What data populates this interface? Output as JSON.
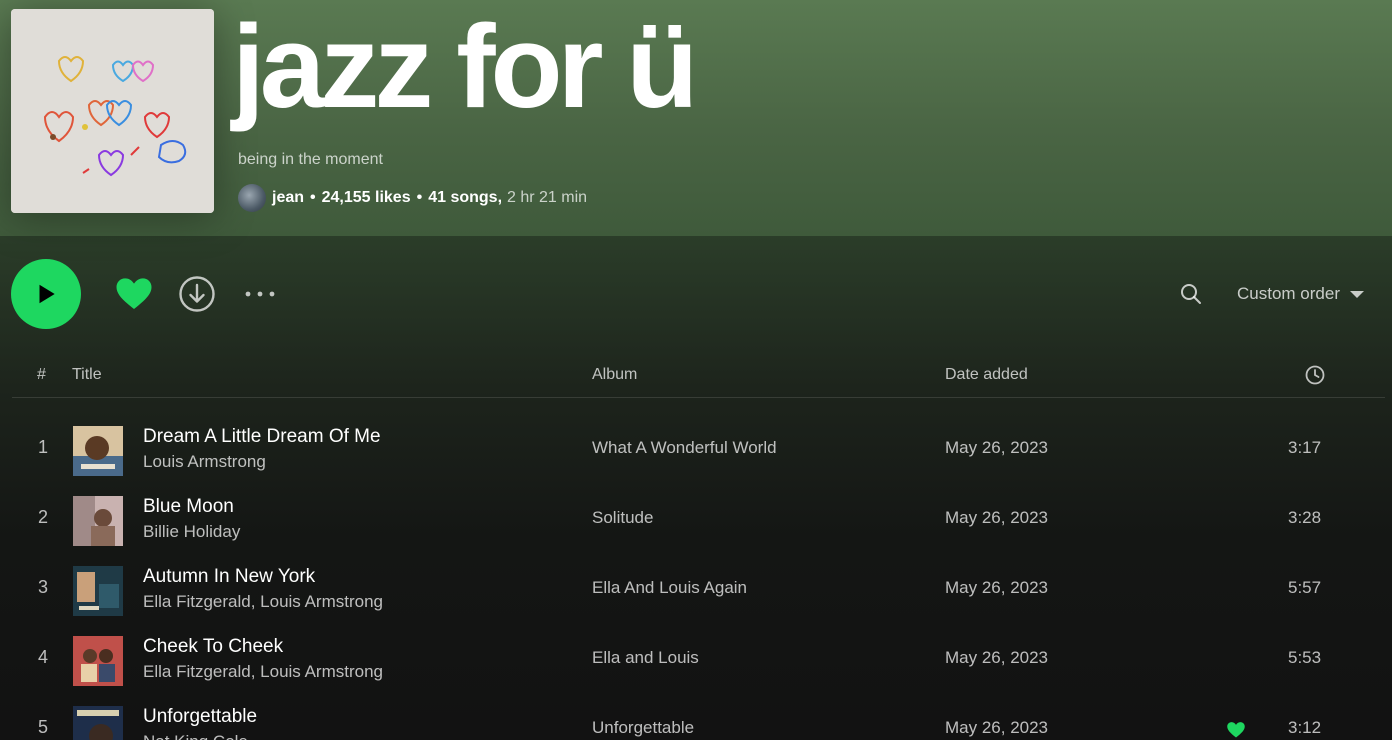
{
  "playlist": {
    "title": "jazz for ü",
    "description": "being in the moment",
    "owner": "jean",
    "likes": "24,155 likes",
    "songs": "41 songs,",
    "duration": "2 hr 21 min",
    "separator": "•"
  },
  "actions": {
    "play_icon": "play-icon",
    "heart_icon": "heart-filled-icon",
    "download_icon": "download-icon",
    "more_icon": "more-options-icon",
    "search_icon": "search-icon",
    "sort_label": "Custom order"
  },
  "columns": {
    "num": "#",
    "title": "Title",
    "album": "Album",
    "date": "Date added",
    "duration_icon": "clock-icon"
  },
  "colors": {
    "accent": "#1ed760",
    "header_bg": "#537149",
    "body_bg": "#121212"
  },
  "tracks": [
    {
      "num": "1",
      "name": "Dream A Little Dream Of Me",
      "artist": "Louis Armstrong",
      "album": "What A Wonderful World",
      "date": "May 26, 2023",
      "duration": "3:17",
      "liked": false
    },
    {
      "num": "2",
      "name": "Blue Moon",
      "artist": "Billie Holiday",
      "album": "Solitude",
      "date": "May 26, 2023",
      "duration": "3:28",
      "liked": false
    },
    {
      "num": "3",
      "name": "Autumn In New York",
      "artist": "Ella Fitzgerald, Louis Armstrong",
      "album": "Ella And Louis Again",
      "date": "May 26, 2023",
      "duration": "5:57",
      "liked": false
    },
    {
      "num": "4",
      "name": "Cheek To Cheek",
      "artist": "Ella Fitzgerald, Louis Armstrong",
      "album": "Ella and Louis",
      "date": "May 26, 2023",
      "duration": "5:53",
      "liked": false
    },
    {
      "num": "5",
      "name": "Unforgettable",
      "artist": "Nat King Cole",
      "album": "Unforgettable",
      "date": "May 26, 2023",
      "duration": "3:12",
      "liked": true
    }
  ]
}
